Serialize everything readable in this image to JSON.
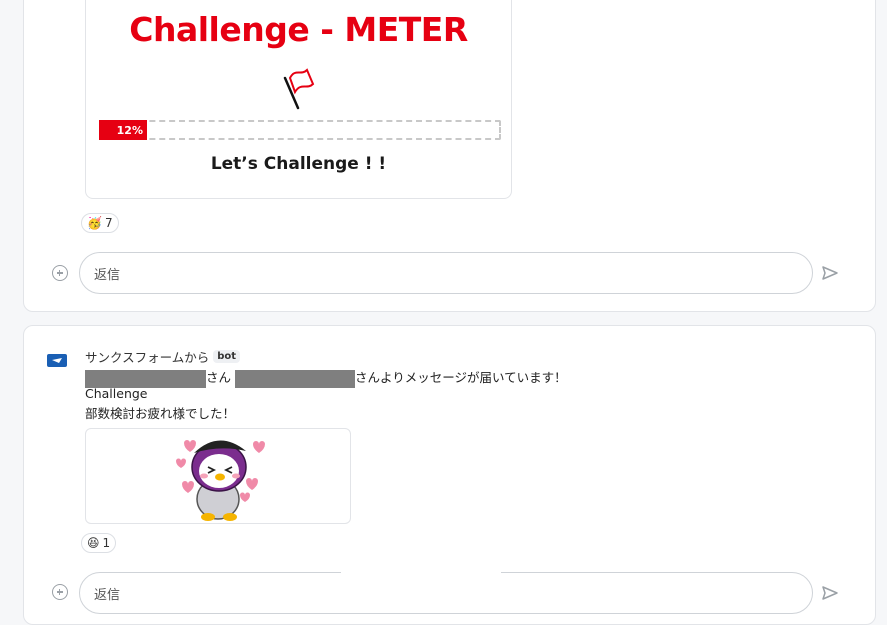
{
  "card1": {
    "meter": {
      "title": "Challenge - METER",
      "progress_label": "12%",
      "progress": 0.12,
      "caption": "Let’s Challenge ! !"
    },
    "reaction": {
      "emoji": "🥳",
      "count": "7"
    },
    "reply": {
      "placeholder": "返信"
    }
  },
  "card2": {
    "sender": "サンクスフォームから",
    "badge": "bot",
    "line1": {
      "middle": "さん",
      "suffix": "さんよりメッセージが届いています！"
    },
    "line2": "Challenge",
    "line3": "部数検討お疲れ様でした！",
    "reaction": {
      "emoji": "😆",
      "count": "1"
    },
    "reply": {
      "placeholder": "返信"
    }
  },
  "colors": {
    "accent_red": "#e60012",
    "bot_blue": "#1a5fb4"
  },
  "icons": [
    "flag-icon",
    "plus-icon",
    "send-icon",
    "bot-avatar-icon",
    "penguin-sticker"
  ]
}
